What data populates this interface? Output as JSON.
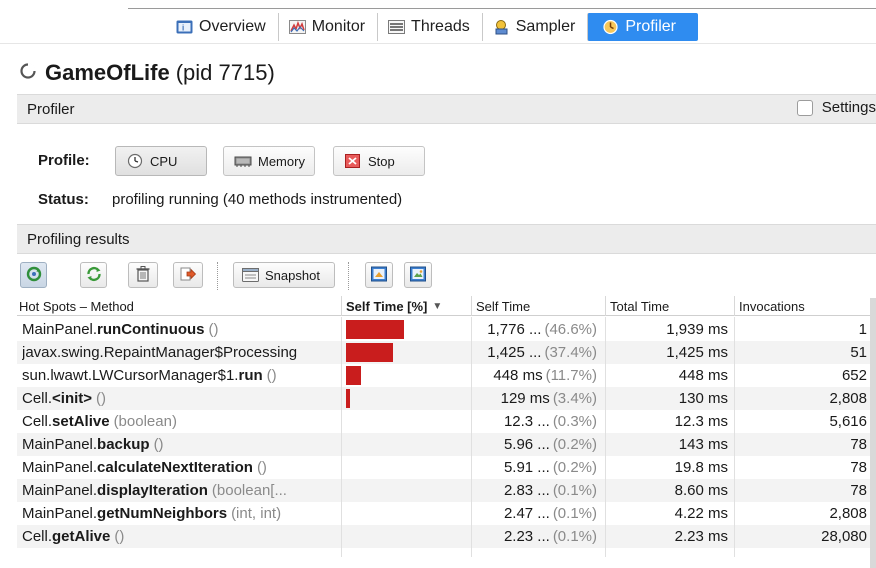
{
  "tabs": [
    {
      "label": "Overview",
      "icon": "overview-icon",
      "active": false
    },
    {
      "label": "Monitor",
      "icon": "monitor-icon",
      "active": false
    },
    {
      "label": "Threads",
      "icon": "threads-icon",
      "active": false
    },
    {
      "label": "Sampler",
      "icon": "sampler-icon",
      "active": false
    },
    {
      "label": "Profiler",
      "icon": "profiler-icon",
      "active": true
    }
  ],
  "title": {
    "process": "GameOfLife",
    "pid": "(pid 7715)"
  },
  "profiler_section": {
    "label": "Profiler",
    "settings_label": "Settings",
    "settings_checked": false
  },
  "profile": {
    "label": "Profile:",
    "cpu_label": "CPU",
    "memory_label": "Memory",
    "stop_label": "Stop"
  },
  "status": {
    "label": "Status:",
    "text": "profiling running (40 methods instrumented)"
  },
  "results_section": {
    "label": "Profiling results"
  },
  "toolbar": {
    "snapshot_label": "Snapshot"
  },
  "table": {
    "columns": [
      "Hot Spots – Method",
      "Self Time [%]",
      "Self Time",
      "Total Time",
      "Invocations"
    ],
    "sorted_column_arrow": "▼",
    "rows": [
      {
        "cls": "MainPanel.",
        "name": "runContinuous",
        "params": "()",
        "self_pct": 46.6,
        "self_time": "1,776 ...",
        "self_pct_label": "(46.6%)",
        "total_time": "1,939 ms",
        "invocations": "1"
      },
      {
        "cls": "javax.swing.RepaintManager$Processing",
        "name": "",
        "params": "",
        "self_pct": 37.4,
        "self_time": "1,425 ...",
        "self_pct_label": "(37.4%)",
        "total_time": "1,425 ms",
        "invocations": "51"
      },
      {
        "cls": "sun.lwawt.LWCursorManager$1.",
        "name": "run",
        "params": "()",
        "self_pct": 11.7,
        "self_time": "448 ms",
        "self_pct_label": "(11.7%)",
        "total_time": "448 ms",
        "invocations": "652"
      },
      {
        "cls": "Cell.",
        "name": "<init>",
        "params": "()",
        "self_pct": 3.4,
        "self_time": "129 ms",
        "self_pct_label": "(3.4%)",
        "total_time": "130 ms",
        "invocations": "2,808"
      },
      {
        "cls": "Cell.",
        "name": "setAlive",
        "params": "(boolean)",
        "self_pct": 0.3,
        "self_time": "12.3 ...",
        "self_pct_label": "(0.3%)",
        "total_time": "12.3 ms",
        "invocations": "5,616"
      },
      {
        "cls": "MainPanel.",
        "name": "backup",
        "params": "()",
        "self_pct": 0.2,
        "self_time": "5.96 ...",
        "self_pct_label": "(0.2%)",
        "total_time": "143 ms",
        "invocations": "78"
      },
      {
        "cls": "MainPanel.",
        "name": "calculateNextIteration",
        "params": "()",
        "self_pct": 0.2,
        "self_time": "5.91 ...",
        "self_pct_label": "(0.2%)",
        "total_time": "19.8 ms",
        "invocations": "78"
      },
      {
        "cls": "MainPanel.",
        "name": "displayIteration",
        "params": "(boolean[...",
        "self_pct": 0.1,
        "self_time": "2.83 ...",
        "self_pct_label": "(0.1%)",
        "total_time": "8.60 ms",
        "invocations": "78"
      },
      {
        "cls": "MainPanel.",
        "name": "getNumNeighbors",
        "params": "(int, int)",
        "self_pct": 0.1,
        "self_time": "2.47 ...",
        "self_pct_label": "(0.1%)",
        "total_time": "4.22 ms",
        "invocations": "2,808"
      },
      {
        "cls": "Cell.",
        "name": "getAlive",
        "params": "()",
        "self_pct": 0.1,
        "self_time": "2.23 ...",
        "self_pct_label": "(0.1%)",
        "total_time": "2.23 ms",
        "invocations": "28,080"
      }
    ]
  },
  "colors": {
    "accent": "#2f8cf0",
    "bar": "#c91d1d"
  }
}
